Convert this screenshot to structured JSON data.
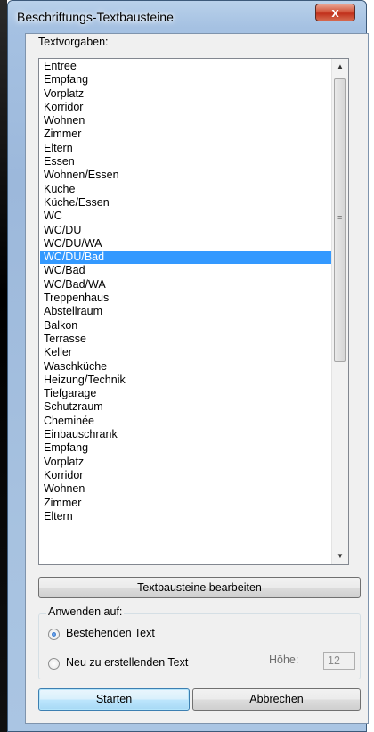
{
  "window": {
    "title": "Beschriftungs-Textbausteine",
    "close_label": "x"
  },
  "list": {
    "label": "Textvorgaben:",
    "selected_index": 14,
    "items": [
      "Entree",
      "Empfang",
      "Vorplatz",
      "Korridor",
      "Wohnen",
      "Zimmer",
      "Eltern",
      "Essen",
      "Wohnen/Essen",
      "Küche",
      "Küche/Essen",
      "WC",
      "WC/DU",
      "WC/DU/WA",
      "WC/DU/Bad",
      "WC/Bad",
      "WC/Bad/WA",
      "Treppenhaus",
      "Abstellraum",
      "Balkon",
      "Terrasse",
      "Keller",
      "Waschküche",
      "Heizung/Technik",
      "Tiefgarage",
      "Schutzraum",
      "Cheminée",
      "Einbauschrank",
      "Empfang",
      "Vorplatz",
      "Korridor",
      "Wohnen",
      "Zimmer",
      "Eltern"
    ],
    "scroll_up_arrow": "▲",
    "scroll_down_arrow": "▼",
    "scroll_grip": "≡"
  },
  "edit_button_label": "Textbausteine bearbeiten",
  "apply_group": {
    "title": "Anwenden auf:",
    "option_existing": "Bestehenden Text",
    "option_new": "Neu zu erstellenden Text",
    "option_existing_checked": true,
    "height_label": "Höhe:",
    "height_value": "12"
  },
  "buttons": {
    "start": "Starten",
    "cancel": "Abbrechen"
  }
}
